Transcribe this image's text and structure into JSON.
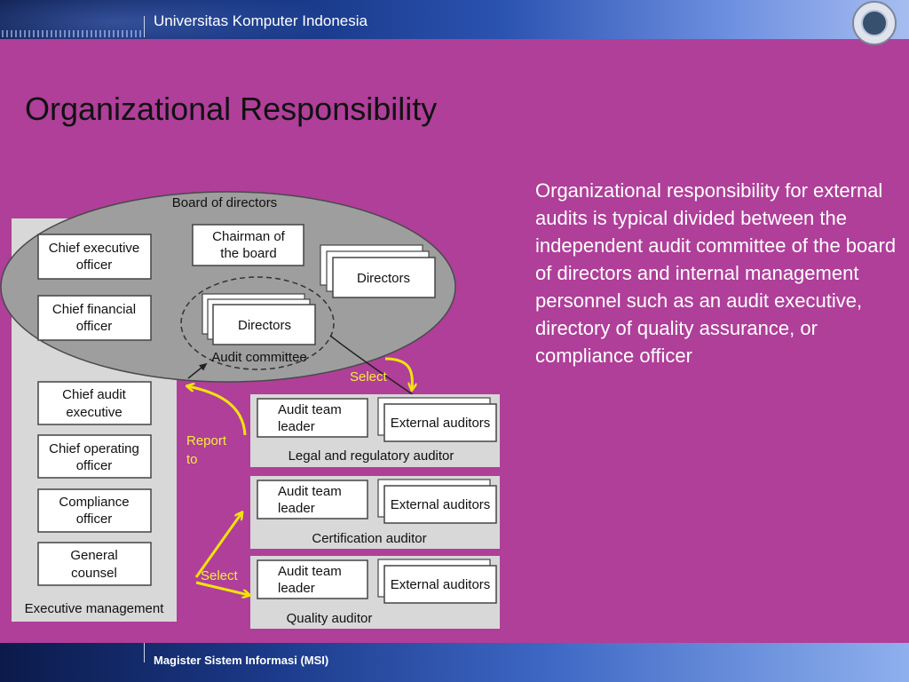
{
  "header": {
    "university": "Universitas Komputer Indonesia"
  },
  "slide": {
    "title": "Organizational Responsibility",
    "body": "Organizational responsibility for external audits is typical divided between the independent audit committee of the board of directors and internal management personnel such as an audit executive, directory of quality assurance, or compliance officer"
  },
  "diagram": {
    "board_label": "Board of directors",
    "exec_label": "Executive management",
    "chief_executive": [
      "Chief executive",
      "officer"
    ],
    "chief_financial": [
      "Chief financial",
      "officer"
    ],
    "chairman": [
      "Chairman of",
      "the board"
    ],
    "directors": "Directors",
    "audit_directors": "Directors",
    "audit_committee": "Audit committee",
    "chief_audit": [
      "Chief audit",
      "executive"
    ],
    "chief_operating": [
      "Chief operating",
      "officer"
    ],
    "compliance": [
      "Compliance",
      "officer"
    ],
    "general_counsel": [
      "General",
      "counsel"
    ],
    "team_leader": [
      "Audit team",
      "leader"
    ],
    "external_auditors": "External auditors",
    "group_legal": "Legal and regulatory auditor",
    "group_cert": "Certification auditor",
    "group_quality": "Quality auditor",
    "select_top": "Select",
    "report_to": [
      "Report",
      "to"
    ],
    "select_bottom": "Select"
  },
  "footer": {
    "text": "Magister Sistem Informasi (MSI)"
  },
  "colors": {
    "background": "#af3f99",
    "arrow": "#f2e30c",
    "annotation": "#f5ec3a"
  }
}
